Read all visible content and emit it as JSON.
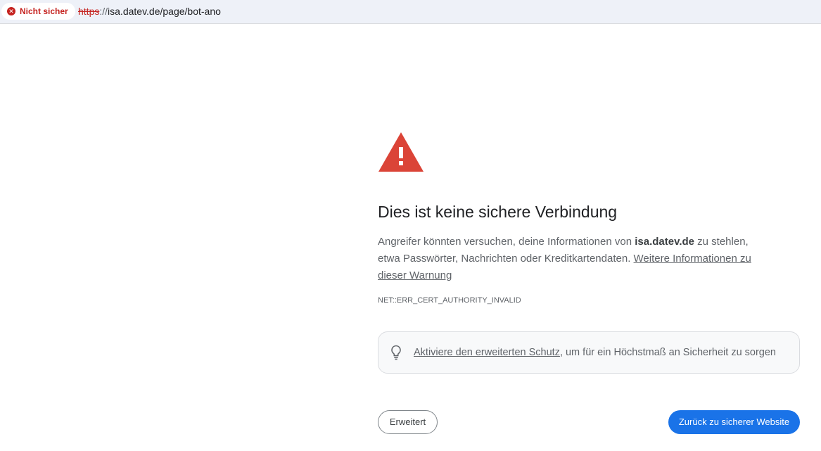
{
  "addressbar": {
    "security_label": "Nicht sicher",
    "url_scheme": "https",
    "url_separator": "://",
    "url_rest": "isa.datev.de/page/bot-ano"
  },
  "interstitial": {
    "title": "Dies ist keine sichere Verbindung",
    "desc_part1": "Angreifer könnten versuchen, deine Informationen von ",
    "desc_host": "isa.datev.de",
    "desc_part2": " zu stehlen, etwa Passwörter, Nachrichten oder Kreditkartendaten. ",
    "desc_link": "Weitere Informationen zu dieser Warnung",
    "error_code": "NET::ERR_CERT_AUTHORITY_INVALID",
    "protection_link": "Aktiviere den erweiterten Schutz",
    "protection_text": ", um für ein Höchstmaß an Sicherheit zu sorgen",
    "advanced_button": "Erweitert",
    "back_button": "Zurück zu sicherer Website"
  },
  "colors": {
    "danger": "#c5221f",
    "warning_triangle": "#db4437",
    "primary_button": "#1a73e8"
  },
  "icons": {
    "security": "not-secure-icon",
    "warning": "warning-triangle-icon",
    "bulb": "lightbulb-icon"
  }
}
